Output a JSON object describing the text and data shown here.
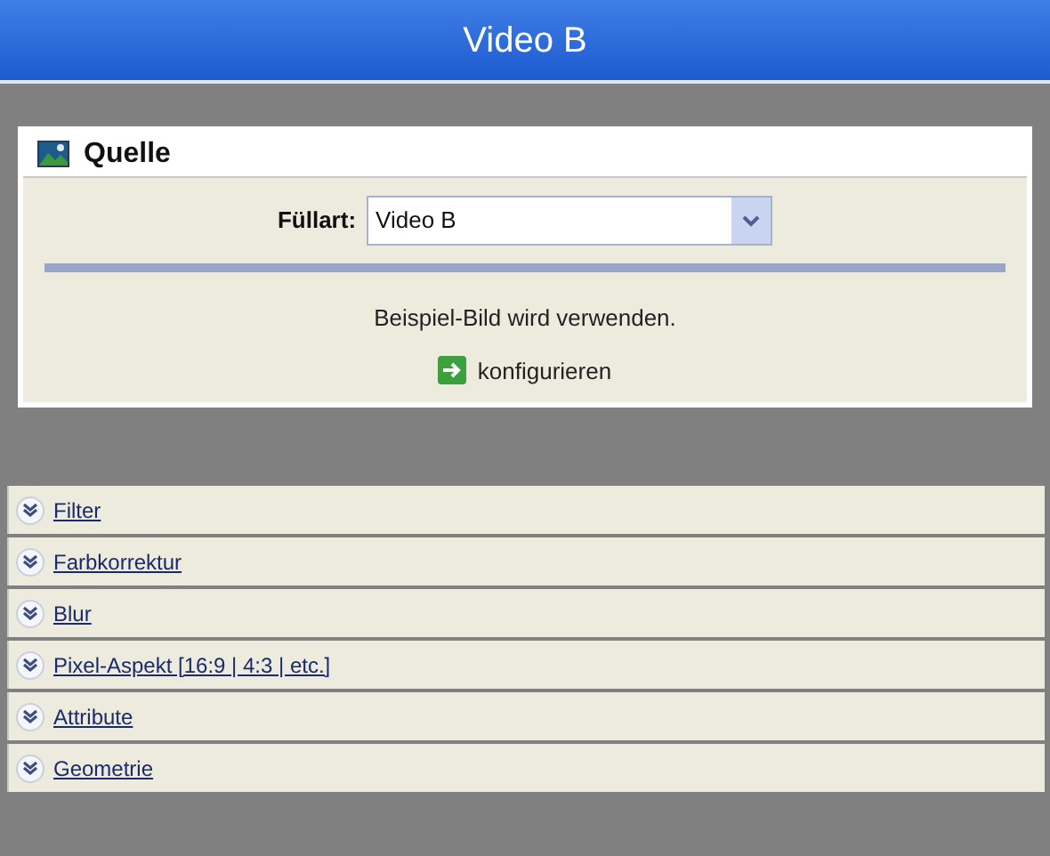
{
  "title": "Video B",
  "source_panel": {
    "title": "Quelle",
    "fill_label": "Füllart:",
    "fill_value": "Video B",
    "message": "Beispiel-Bild wird verwenden.",
    "configure_link": "konfigurieren"
  },
  "sections": [
    {
      "label": "Filter",
      "expanded": false
    },
    {
      "label": "Farbkorrektur",
      "expanded": false
    },
    {
      "label": "Blur",
      "expanded": false
    },
    {
      "label": "Pixel-Aspekt [16:9 | 4:3 | etc.]",
      "expanded": false
    },
    {
      "label": "Attribute",
      "expanded": false
    },
    {
      "label": "Geometrie",
      "expanded": false
    }
  ]
}
